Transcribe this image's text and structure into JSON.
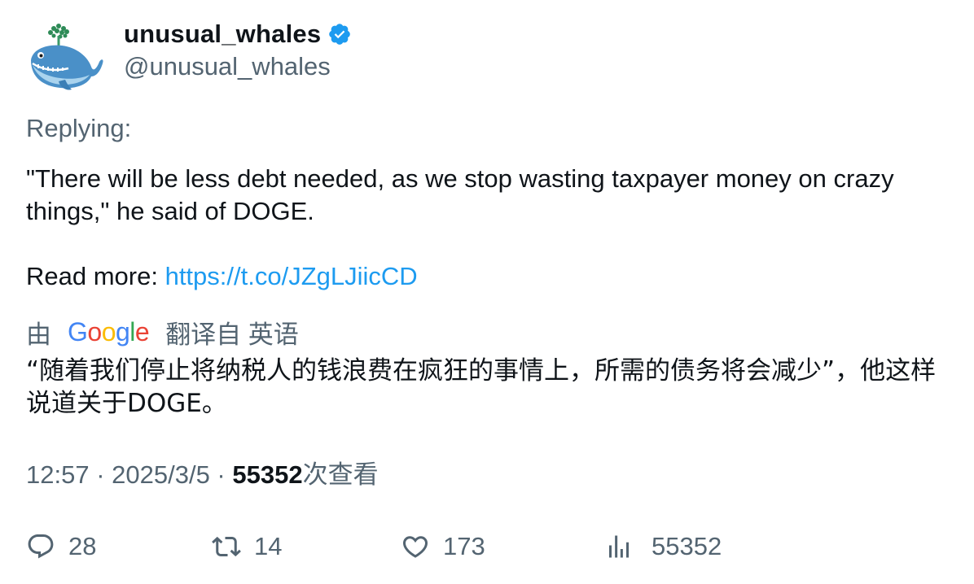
{
  "author": {
    "display_name": "unusual_whales",
    "handle": "@unusual_whales",
    "verified": true,
    "avatar_icon": "whale-avatar-icon",
    "verified_color": "#1d9bf0"
  },
  "replying_label": "Replying:",
  "tweet": {
    "line1": "\"There will be less debt needed, as we stop wasting taxpayer money on crazy things,\" he said of DOGE.",
    "read_more_label": "Read more: ",
    "link_text": "https://t.co/JZgLJiicCD"
  },
  "translation": {
    "prefix": "由",
    "google_letters": [
      "G",
      "o",
      "o",
      "g",
      "l",
      "e"
    ],
    "suffix": "翻译自 英语",
    "text": "“随着我们停止将纳税人的钱浪费在疯狂的事情上，所需的债务将会减少”，他这样说道关于DOGE。"
  },
  "meta": {
    "time": "12:57",
    "separator": " · ",
    "date": "2025/3/5",
    "views_count": "55352",
    "views_label": "次查看"
  },
  "actions": {
    "replies": "28",
    "retweets": "14",
    "likes": "173",
    "views": "55352"
  },
  "colors": {
    "link": "#1d9bf0",
    "secondary_text": "#536471",
    "primary_text": "#0f1419"
  }
}
